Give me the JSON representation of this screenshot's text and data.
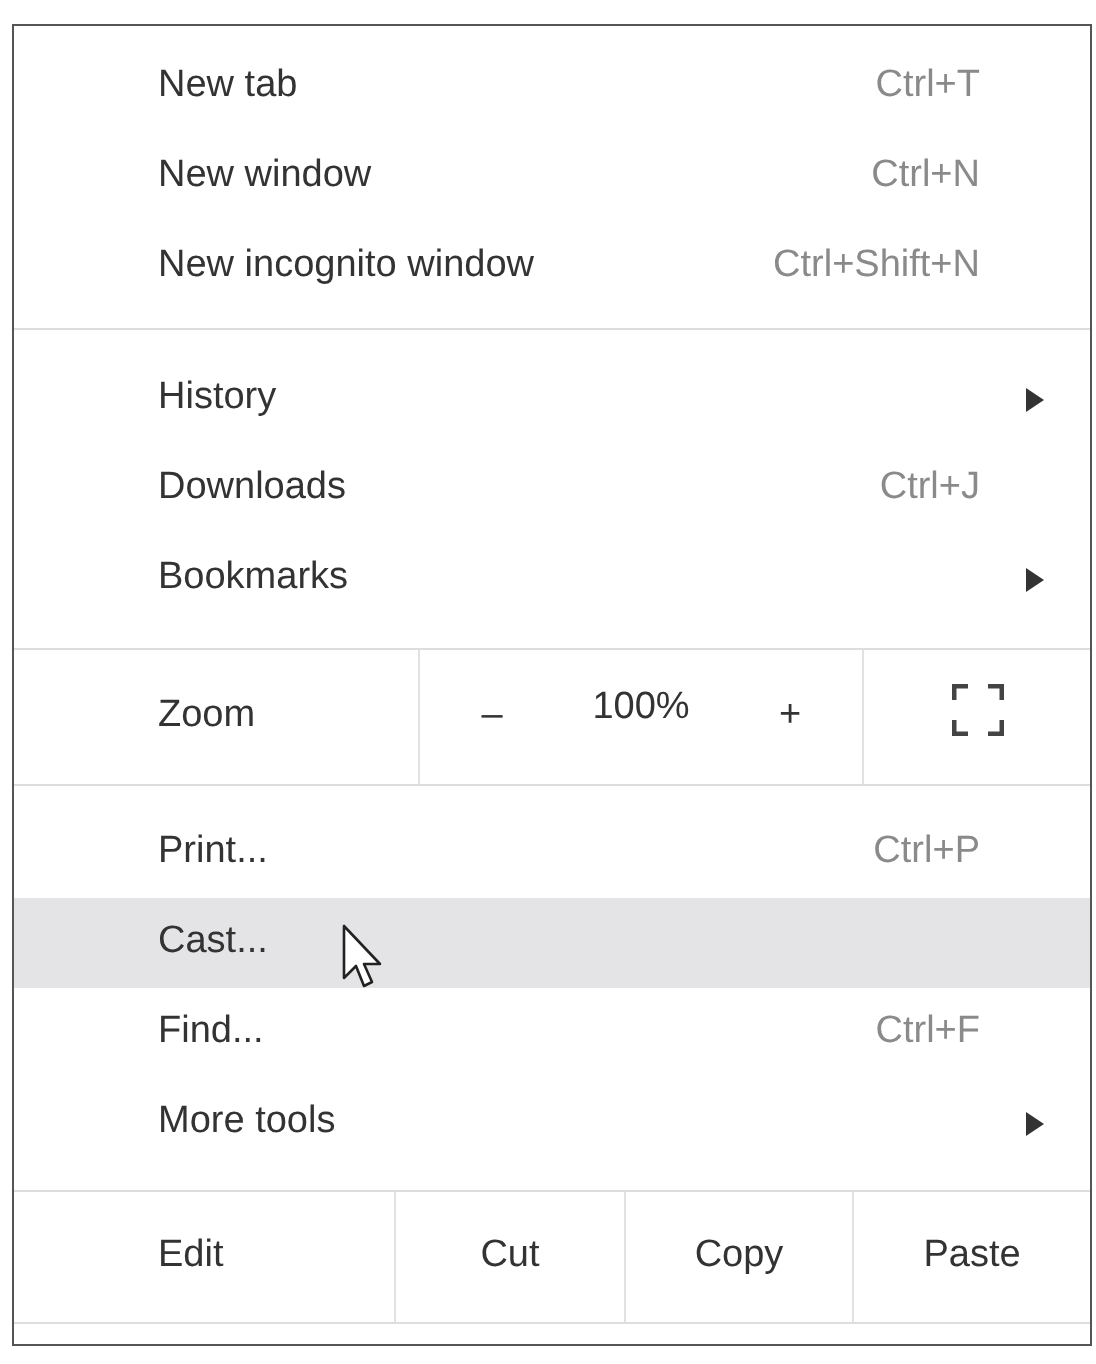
{
  "menu": {
    "sections": [
      {
        "kind": "items",
        "items": [
          {
            "label": "New tab",
            "shortcut": "Ctrl+T",
            "submenu": false,
            "highlighted": false
          },
          {
            "label": "New window",
            "shortcut": "Ctrl+N",
            "submenu": false,
            "highlighted": false
          },
          {
            "label": "New incognito window",
            "shortcut": "Ctrl+Shift+N",
            "submenu": false,
            "highlighted": false
          }
        ]
      },
      {
        "kind": "items",
        "items": [
          {
            "label": "History",
            "submenu": true,
            "highlighted": false
          },
          {
            "label": "Downloads",
            "shortcut": "Ctrl+J",
            "submenu": false,
            "highlighted": false
          },
          {
            "label": "Bookmarks",
            "submenu": true,
            "highlighted": false
          }
        ]
      },
      {
        "kind": "zoom",
        "label": "Zoom",
        "minus": "–",
        "value": "100%",
        "plus": "+"
      },
      {
        "kind": "items",
        "items": [
          {
            "label": "Print...",
            "shortcut": "Ctrl+P",
            "submenu": false,
            "highlighted": false
          },
          {
            "label": "Cast...",
            "submenu": false,
            "highlighted": true
          },
          {
            "label": "Find...",
            "shortcut": "Ctrl+F",
            "submenu": false,
            "highlighted": false
          },
          {
            "label": "More tools",
            "submenu": true,
            "highlighted": false
          }
        ]
      },
      {
        "kind": "edit",
        "label": "Edit",
        "buttons": [
          "Cut",
          "Copy",
          "Paste"
        ]
      }
    ]
  }
}
